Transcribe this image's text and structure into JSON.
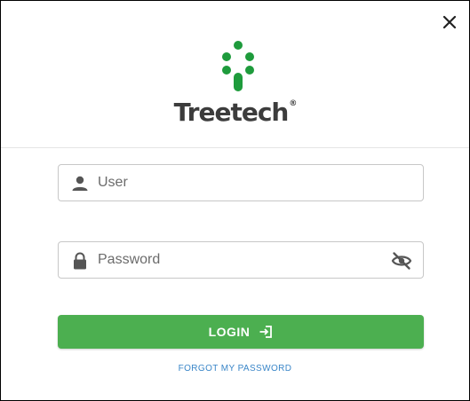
{
  "dialog": {
    "brand_name": "Treetech",
    "brand_mark": "®",
    "close_icon": "close-icon"
  },
  "form": {
    "user": {
      "placeholder": "User",
      "value": "",
      "icon": "person-icon"
    },
    "password": {
      "placeholder": "Password",
      "value": "",
      "icon": "lock-icon",
      "toggle_icon": "eye-off-icon"
    },
    "login_label": "LOGIN",
    "login_icon": "login-icon",
    "forgot_label": "FORGOT MY PASSWORD"
  },
  "colors": {
    "accent": "#4caf50",
    "logo_green": "#1e9b3c",
    "link": "#3a86c8"
  }
}
